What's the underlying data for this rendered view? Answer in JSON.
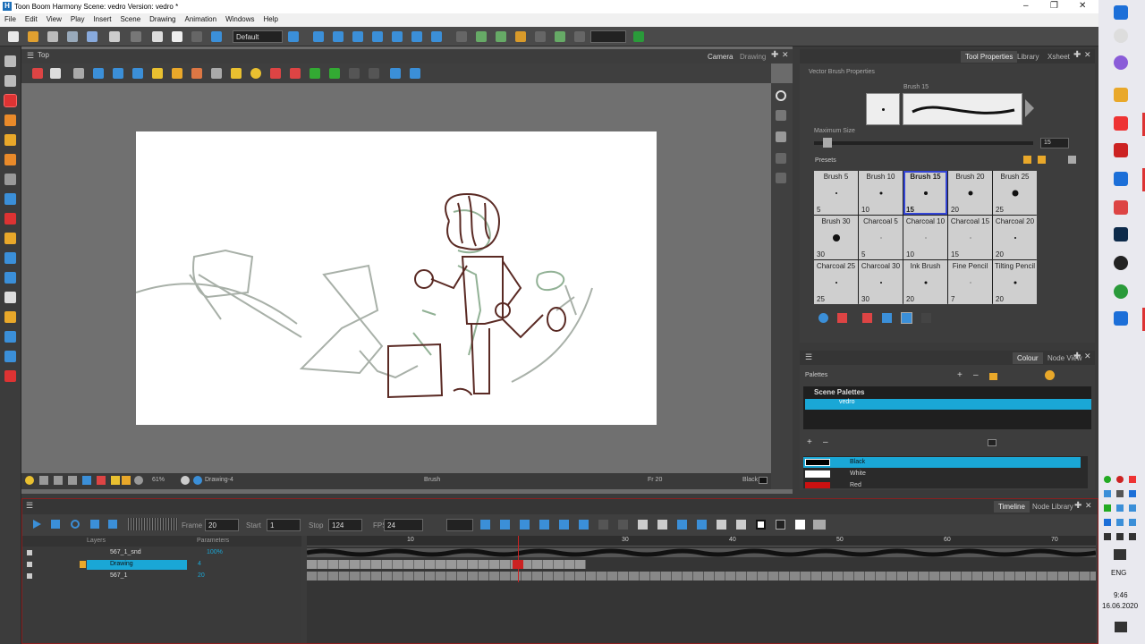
{
  "window": {
    "title": "Toon Boom Harmony Scene: vedro Version: vedro *",
    "logo": "H"
  },
  "menu": [
    "File",
    "Edit",
    "View",
    "Play",
    "Insert",
    "Scene",
    "Drawing",
    "Animation",
    "Windows",
    "Help"
  ],
  "toolbar": {
    "workspace": "Default"
  },
  "camera_view": {
    "breadcrumb": "Top",
    "tabs": [
      "Camera",
      "Drawing"
    ],
    "status": {
      "zoom": "61%",
      "layer": "Drawing-4",
      "tool": "Brush",
      "frame": "Fr 20",
      "color": "Black"
    }
  },
  "tool_properties": {
    "tabs": [
      "Tool Properties",
      "Library",
      "Xsheet"
    ],
    "section": "Vector Brush Properties",
    "brush_name": "Brush 15",
    "max_size_label": "Maximum Size",
    "max_size_value": "15",
    "presets_label": "Presets",
    "presets": [
      {
        "name": "Brush 5",
        "size": "5",
        "dot": 2
      },
      {
        "name": "Brush 10",
        "size": "10",
        "dot": 3
      },
      {
        "name": "Brush 15",
        "size": "15",
        "dot": 4,
        "selected": true
      },
      {
        "name": "Brush 20",
        "size": "20",
        "dot": 5
      },
      {
        "name": "Brush 25",
        "size": "25",
        "dot": 7
      },
      {
        "name": "Brush 30",
        "size": "30",
        "dot": 8
      },
      {
        "name": "Charcoal 5",
        "size": "5",
        "dot": 1
      },
      {
        "name": "Charcoal 10",
        "size": "10",
        "dot": 1
      },
      {
        "name": "Charcoal 15",
        "size": "15",
        "dot": 1
      },
      {
        "name": "Charcoal 20",
        "size": "20",
        "dot": 2
      },
      {
        "name": "Charcoal 25",
        "size": "25",
        "dot": 2
      },
      {
        "name": "Charcoal 30",
        "size": "30",
        "dot": 2
      },
      {
        "name": "Ink Brush",
        "size": "20",
        "dot": 3
      },
      {
        "name": "Fine Pencil",
        "size": "7",
        "dot": 1
      },
      {
        "name": "Tilting Pencil",
        "size": "20",
        "dot": 3
      }
    ]
  },
  "colour": {
    "tabs": [
      "Colour",
      "Node View"
    ],
    "palettes_label": "Palettes",
    "scene_palettes": "Scene Palettes",
    "palette": "vedro",
    "swatches": [
      {
        "name": "Black",
        "color": "#000000",
        "selected": true
      },
      {
        "name": "White",
        "color": "#ffffff"
      },
      {
        "name": "Red",
        "color": "#cc1111"
      }
    ]
  },
  "timeline": {
    "tabs": [
      "Timeline",
      "Node Library"
    ],
    "frame_label": "Frame",
    "frame": "20",
    "start_label": "Start",
    "start": "1",
    "stop_label": "Stop",
    "stop": "124",
    "fps_label": "FPS",
    "fps": "24",
    "layers_header": "Layers",
    "parameters_header": "Parameters",
    "ruler": [
      "10",
      "30",
      "40",
      "50",
      "60",
      "70"
    ],
    "layers": [
      {
        "name": "567_1_snd",
        "param": "100%"
      },
      {
        "name": "Drawing",
        "param": "4",
        "selected": true
      },
      {
        "name": "567_1",
        "param": "20"
      }
    ]
  },
  "taskbar": {
    "time": "9:46",
    "date": "16.06.2020",
    "lang": "ENG"
  },
  "colors": {
    "accent": "#1aa7d6",
    "selection": "#3445d6",
    "timeline_border": "#8a1f1f"
  }
}
